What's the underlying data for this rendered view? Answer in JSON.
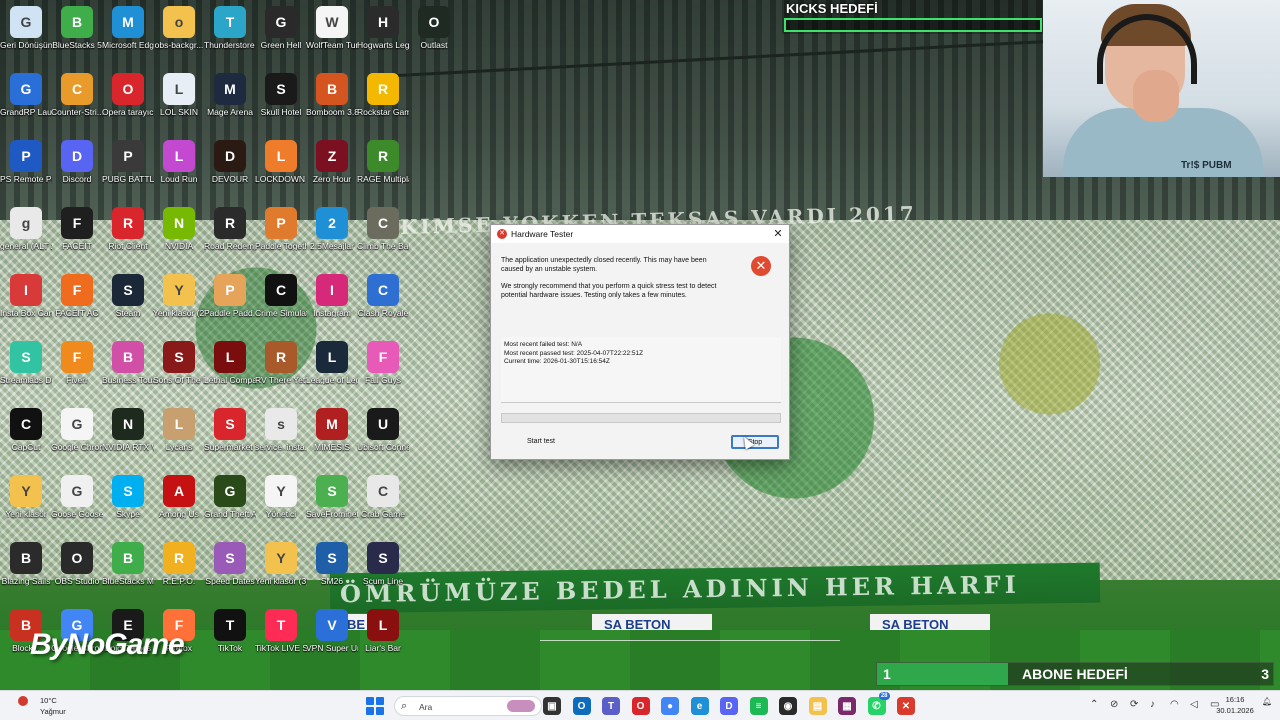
{
  "wallpaper": {
    "banner_top": "KIMSE YOKKEN TEKSAS VARDI 2017",
    "banner_bottom": "ÖMRÜMÜZE BEDEL ADININ HER HARFI",
    "ad_left": "SA BETON",
    "ad_right": "SA BETON",
    "ad_partial": "BE"
  },
  "desktop_icons": [
    {
      "label": "Geri Dönüşüm",
      "icon": "recycle-bin-icon",
      "color": "#cfe3f5"
    },
    {
      "label": "BlueStacks 5",
      "icon": "bluestacks-icon",
      "color": "#3fae4a"
    },
    {
      "label": "Microsoft Edge",
      "icon": "edge-icon",
      "color": "#1f8fd6"
    },
    {
      "label": "obs-backgr...",
      "icon": "folder-icon",
      "color": "#f2c14e"
    },
    {
      "label": "Thunderstore Mod Mana...",
      "icon": "thunderstore-icon",
      "color": "#2ba6c9"
    },
    {
      "label": "Green Hell",
      "icon": "green-hell-icon",
      "color": "#2a2a2a"
    },
    {
      "label": "WolfTeam Turkiye",
      "icon": "file-icon",
      "color": "#f5f5f5"
    },
    {
      "label": "Hogwarts Legacy",
      "icon": "hogwarts-icon",
      "color": "#2b2b2b"
    },
    {
      "label": "Outlast",
      "icon": "outlast-icon",
      "color": "#1e2a22"
    },
    {
      "label": "GrandRP Launcher",
      "icon": "grandrp-icon",
      "color": "#2a6fd8"
    },
    {
      "label": "Counter-Stri... 2",
      "icon": "counter-strike-icon",
      "color": "#e89b2a"
    },
    {
      "label": "Opera tarayıcı",
      "icon": "opera-icon",
      "color": "#d8262c"
    },
    {
      "label": "LOL SKIN",
      "icon": "lol-skin-icon",
      "color": "#e8eef5"
    },
    {
      "label": "Mage Arena",
      "icon": "mage-arena-icon",
      "color": "#1d2a3f"
    },
    {
      "label": "Skull Hotel",
      "icon": "skull-hotel-icon",
      "color": "#1a1a1a"
    },
    {
      "label": "Bomboom 3.8.7",
      "icon": "bomboom-icon",
      "color": "#d4551f"
    },
    {
      "label": "Rockstar Games ...",
      "icon": "rockstar-icon",
      "color": "#f5b800"
    },
    {
      "label": "PS Remote Play",
      "icon": "ps-remote-icon",
      "color": "#1e59c4"
    },
    {
      "label": "Discord",
      "icon": "discord-icon",
      "color": "#5865f2"
    },
    {
      "label": "PUBG BATTLEGR...",
      "icon": "pubg-icon",
      "color": "#3a3a3a"
    },
    {
      "label": "Loud Run",
      "icon": "loud-run-icon",
      "color": "#c34ad0"
    },
    {
      "label": "DEVOUR",
      "icon": "devour-icon",
      "color": "#2b1a14"
    },
    {
      "label": "LOCKDOWN Protocol",
      "icon": "lockdown-icon",
      "color": "#ef7c2a"
    },
    {
      "label": "Zero Hour",
      "icon": "zero-hour-icon",
      "color": "#7a1020"
    },
    {
      "label": "RAGE Multiplayer",
      "icon": "rage-mp-icon",
      "color": "#3d8a2a"
    },
    {
      "label": "general (ALT 2)",
      "icon": "settings-file-icon",
      "color": "#e9e9e9"
    },
    {
      "label": "FACEIT",
      "icon": "faceit-icon",
      "color": "#1f1f1f"
    },
    {
      "label": "Riot Client",
      "icon": "riot-icon",
      "color": "#d8262c"
    },
    {
      "label": "NVIDIA",
      "icon": "nvidia-icon",
      "color": "#76b900"
    },
    {
      "label": "Road Redemption",
      "icon": "road-redemption-icon",
      "color": "#2b2b2b"
    },
    {
      "label": "Paddle Togeth...",
      "icon": "paddle-together-icon",
      "color": "#e07a2c"
    },
    {
      "label": "2.5Mesajlar",
      "icon": "edge-icon",
      "color": "#1f8fd6"
    },
    {
      "label": "Climb The Backrooms",
      "icon": "backrooms-icon",
      "color": "#6b6b5e"
    },
    {
      "label": "Insta Box Canlı İndir Tr Info",
      "icon": "instabox-icon",
      "color": "#d83a3a"
    },
    {
      "label": "FACEIT AC",
      "icon": "faceit-ac-icon",
      "color": "#ef6c1f"
    },
    {
      "label": "Steam",
      "icon": "steam-icon",
      "color": "#1b2838"
    },
    {
      "label": "Yeni klasör (2)",
      "icon": "folder-icon",
      "color": "#f2c14e"
    },
    {
      "label": "Paddle Padd...",
      "icon": "paddle-icon",
      "color": "#e6a35a"
    },
    {
      "label": "Crime Simulator",
      "icon": "crime-sim-icon",
      "color": "#111111"
    },
    {
      "label": "Instagram",
      "icon": "instagram-icon",
      "color": "#d6297a"
    },
    {
      "label": "Clash Royale",
      "icon": "clash-royale-icon",
      "color": "#2f6fd2"
    },
    {
      "label": "Streamlabs Desktop",
      "icon": "streamlabs-icon",
      "color": "#31c3a2"
    },
    {
      "label": "Fiverr",
      "icon": "fiverr-icon",
      "color": "#f08a1c"
    },
    {
      "label": "Business Tour - Online Mu...",
      "icon": "business-tour-icon",
      "color": "#d24fa8"
    },
    {
      "label": "Sons Of The Forest",
      "icon": "sons-forest-icon",
      "color": "#8a1a1a"
    },
    {
      "label": "Lethal Company",
      "icon": "lethal-company-icon",
      "color": "#7a0e0e"
    },
    {
      "label": "RV There Yet?",
      "icon": "rv-there-yet-icon",
      "color": "#a85a2a"
    },
    {
      "label": "League of Legends",
      "icon": "league-icon",
      "color": "#1a2a3a"
    },
    {
      "label": "Fall Guys",
      "icon": "fall-guys-icon",
      "color": "#e85ab8"
    },
    {
      "label": "CapCut",
      "icon": "capcut-icon",
      "color": "#111111"
    },
    {
      "label": "Google Chrome",
      "icon": "file-icon",
      "color": "#f5f5f5"
    },
    {
      "label": "NVIDIA RTX Voice",
      "icon": "rtx-voice-icon",
      "color": "#1e2a1e"
    },
    {
      "label": "Lycans",
      "icon": "lycans-icon",
      "color": "#c8a070"
    },
    {
      "label": "Supermarket Together",
      "icon": "supermarket-icon",
      "color": "#d8262c"
    },
    {
      "label": "service_insta...",
      "icon": "settings-file-icon",
      "color": "#e9e9e9"
    },
    {
      "label": "MIMESIS",
      "icon": "mimesis-icon",
      "color": "#b02020"
    },
    {
      "label": "Ubisoft Connect",
      "icon": "ubisoft-icon",
      "color": "#1a1a1a"
    },
    {
      "label": "Yeni klasör",
      "icon": "folder-icon",
      "color": "#f2c14e"
    },
    {
      "label": "Goose Goose Duck",
      "icon": "goose-icon",
      "color": "#f0f0f0"
    },
    {
      "label": "Skype",
      "icon": "skype-icon",
      "color": "#00aff0"
    },
    {
      "label": "Among Us",
      "icon": "among-us-icon",
      "color": "#c51111"
    },
    {
      "label": "Grand Theft Auto V Le...",
      "icon": "gta-v-icon",
      "color": "#2a4a1a"
    },
    {
      "label": "Yönetici",
      "icon": "file-icon",
      "color": "#f5f5f5"
    },
    {
      "label": "SaveFrominet",
      "icon": "download-icon",
      "color": "#4caf50"
    },
    {
      "label": "Crab Game",
      "icon": "crab-game-icon",
      "color": "#e8e8e8"
    },
    {
      "label": "Blazing Sails",
      "icon": "blazing-sails-icon",
      "color": "#2b2b2b"
    },
    {
      "label": "OBS Studio",
      "icon": "obs-icon",
      "color": "#2a2a2a"
    },
    {
      "label": "BlueStacks Multi-Insta...",
      "icon": "bluestacks-icon",
      "color": "#3fae4a"
    },
    {
      "label": "R.E.P.O.",
      "icon": "repo-icon",
      "color": "#f0b020"
    },
    {
      "label": "Speed Dates",
      "icon": "speed-dates-icon",
      "color": "#9a5ab8"
    },
    {
      "label": "Yeni klasör (3)",
      "icon": "folder-icon",
      "color": "#f2c14e"
    },
    {
      "label": "SM26",
      "icon": "sm26-icon",
      "color": "#1f5fa8"
    },
    {
      "label": "Scum Line",
      "icon": "scum-line-icon",
      "color": "#2a2a4a"
    },
    {
      "label": "Block...",
      "icon": "block-icon",
      "color": "#c83020"
    },
    {
      "label": "Google Chrome",
      "icon": "chrome-icon",
      "color": "#4285f4"
    },
    {
      "label": "Epic Games",
      "icon": "epic-games-icon",
      "color": "#1a1a1a"
    },
    {
      "label": "Firefox",
      "icon": "firefox-icon",
      "color": "#ff7139"
    },
    {
      "label": "TikTok",
      "icon": "tiktok-icon",
      "color": "#111111"
    },
    {
      "label": "TikTok LIVE Studio",
      "icon": "tiktok-live-icon",
      "color": "#fe2c55"
    },
    {
      "label": "VPN Super Unlimite...",
      "icon": "vpn-icon",
      "color": "#2b6fd8"
    },
    {
      "label": "Liar's Bar",
      "icon": "liars-bar-icon",
      "color": "#8a0f0f"
    }
  ],
  "stream_overlay": {
    "kicks_title": "KICKS HEDEFİ",
    "kicks_progress": 0,
    "subs_current": "1",
    "subs_title": "ABONE HEDEFİ",
    "subs_goal": "3",
    "subs_progress": 0.33,
    "watermark": "ByNoGame",
    "webcam_shirt_text": "Tr!$ PUBM"
  },
  "dialog": {
    "title": "Hardware Tester",
    "close_glyph": "✕",
    "message_1": "The application unexpectedly closed recently. This may have been caused by an unstable system.",
    "message_2": "We strongly recommend that you perform a quick stress test to detect potential hardware issues. Testing only takes a few minutes.",
    "info_failed": "Most recent failed test: N/A",
    "info_passed": "Most recent passed test: 2025-04-07T22:22:51Z",
    "info_current": "Current time: 2026-01-30T15:16:54Z",
    "progress": 0,
    "start_button": "Start test",
    "stop_button": "Stop"
  },
  "taskbar": {
    "weather_temp": "10°C",
    "weather_condition": "Yağmur",
    "search_placeholder": "Ara",
    "whatsapp_badge": "28",
    "clock_time": "16:16",
    "clock_date": "30.01.2026",
    "apps": [
      {
        "icon": "task-view-icon",
        "color": "#333333",
        "glyph": "▣"
      },
      {
        "icon": "outlook-icon",
        "color": "#0f6cbd",
        "glyph": "O"
      },
      {
        "icon": "teams-icon",
        "color": "#5b5fc7",
        "glyph": "T"
      },
      {
        "icon": "opera-icon",
        "color": "#d8262c",
        "glyph": "O"
      },
      {
        "icon": "chrome-icon",
        "color": "#4285f4",
        "glyph": "●"
      },
      {
        "icon": "edge-icon",
        "color": "#1f8fd6",
        "glyph": "e"
      },
      {
        "icon": "discord-icon",
        "color": "#5865f2",
        "glyph": "D"
      },
      {
        "icon": "spotify-icon",
        "color": "#1db954",
        "glyph": "≡"
      },
      {
        "icon": "obs-icon",
        "color": "#2a2a2a",
        "glyph": "◉"
      },
      {
        "icon": "file-explorer-icon",
        "color": "#f2c14e",
        "glyph": "▤"
      },
      {
        "icon": "winrar-icon",
        "color": "#7a2a6a",
        "glyph": "▦"
      },
      {
        "icon": "whatsapp-icon",
        "color": "#25d366",
        "glyph": "✆"
      },
      {
        "icon": "hardware-tester-icon",
        "color": "#d93a2b",
        "glyph": "✕"
      }
    ],
    "tray": [
      {
        "icon": "chevron-up-icon",
        "glyph": "⌃"
      },
      {
        "icon": "network-off-icon",
        "glyph": "⊘"
      },
      {
        "icon": "sync-icon",
        "glyph": "⟳"
      },
      {
        "icon": "mic-icon",
        "glyph": "♪"
      },
      {
        "icon": "wifi-icon",
        "glyph": "◠"
      },
      {
        "icon": "speaker-icon",
        "glyph": "◁"
      },
      {
        "icon": "battery-icon",
        "glyph": "▭"
      }
    ]
  }
}
